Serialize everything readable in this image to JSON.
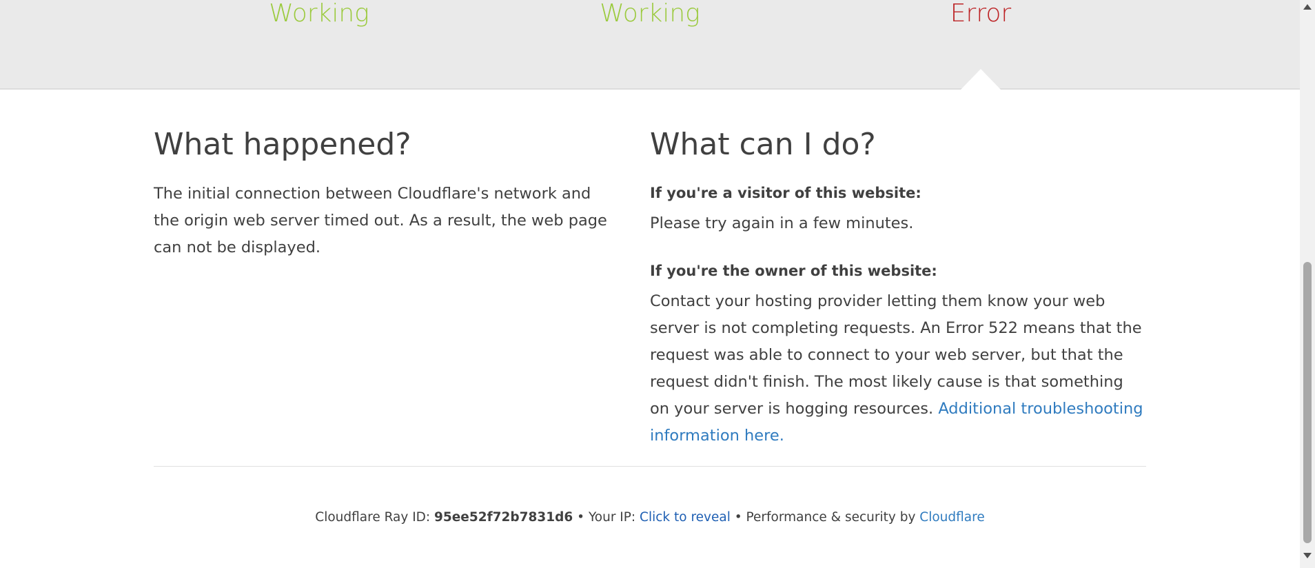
{
  "status": {
    "items": [
      {
        "label": "Working",
        "state": "working"
      },
      {
        "label": "Working",
        "state": "working"
      },
      {
        "label": "Error",
        "state": "error"
      }
    ],
    "colors": {
      "working": "#9bca3e",
      "error": "#bd2426"
    }
  },
  "what_happened": {
    "heading": "What happened?",
    "text": "The initial connection between Cloudflare's network and the origin web server timed out. As a result, the web page can not be displayed."
  },
  "what_can_i_do": {
    "heading": "What can I do?",
    "visitor_heading": "If you're a visitor of this website:",
    "visitor_text": "Please try again in a few minutes.",
    "owner_heading": "If you're the owner of this website:",
    "owner_text": "Contact your hosting provider letting them know your web server is not completing requests. An Error 522 means that the request was able to connect to your web server, but that the request didn't finish. The most likely cause is that something on your server is hogging resources. ",
    "owner_link": "Additional troubleshooting information here."
  },
  "footer": {
    "ray_label": "Cloudflare Ray ID: ",
    "ray_id": "95ee52f72b7831d6",
    "sep1": " • ",
    "ip_label": "Your IP: ",
    "ip_reveal": "Click to reveal",
    "sep2": " • ",
    "perf_label": "Performance & security by ",
    "brand_link": "Cloudflare"
  },
  "scrollbar": {
    "up_icon": "scroll-up-arrow-icon",
    "down_icon": "scroll-down-arrow-icon"
  }
}
